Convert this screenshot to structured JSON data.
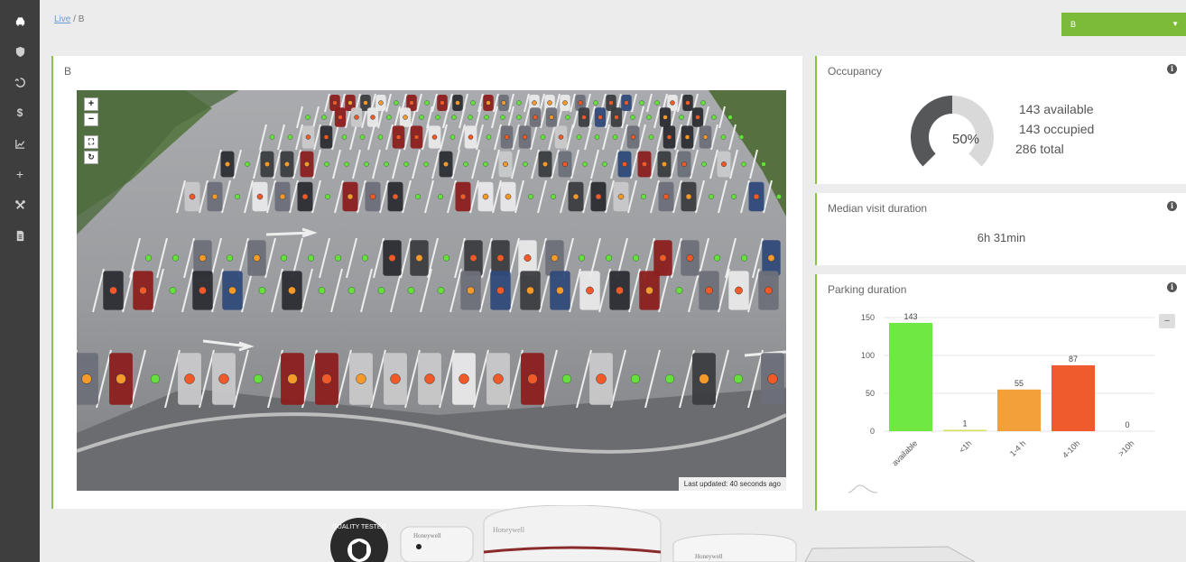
{
  "sidebar": {
    "items": [
      {
        "icon": "car-icon",
        "glyph": "car"
      },
      {
        "icon": "shield-icon",
        "glyph": "shield"
      },
      {
        "icon": "history-icon",
        "glyph": "history"
      },
      {
        "icon": "dollar-icon",
        "glyph": "$"
      },
      {
        "icon": "chart-icon",
        "glyph": "chart"
      },
      {
        "icon": "plus-icon",
        "glyph": "+"
      },
      {
        "icon": "tools-icon",
        "glyph": "tools"
      },
      {
        "icon": "document-icon",
        "glyph": "doc"
      }
    ]
  },
  "breadcrumb": {
    "link": "Live",
    "separator": " / ",
    "current": "B"
  },
  "zone_select": {
    "value": "B"
  },
  "camera": {
    "title": "B",
    "last_updated": "Last updated: 40 seconds ago",
    "controls": {
      "zoom_in": "+",
      "zoom_out": "−"
    }
  },
  "occupancy": {
    "title": "Occupancy",
    "percent_label": "50%",
    "occupied_fraction": 0.5,
    "available": "143 available",
    "occupied": "143 occupied",
    "total": "286 total",
    "colors": {
      "occupied": "#555759",
      "available": "#d9d9d9"
    }
  },
  "median": {
    "title": "Median visit duration",
    "value": "6h 31min"
  },
  "parking": {
    "title": "Parking duration",
    "collapse": "–"
  },
  "chart_data": {
    "type": "bar",
    "categories": [
      "available",
      "<1h",
      "1-4 h",
      "4-10h",
      ">10h"
    ],
    "values": [
      143,
      1,
      55,
      87,
      0
    ],
    "colors": [
      "#6fe843",
      "#d4e157",
      "#f2a03a",
      "#ef5b2c",
      "#999999"
    ],
    "ylim": [
      0,
      150
    ],
    "yticks": [
      0,
      50,
      100,
      150
    ],
    "grid": true
  }
}
